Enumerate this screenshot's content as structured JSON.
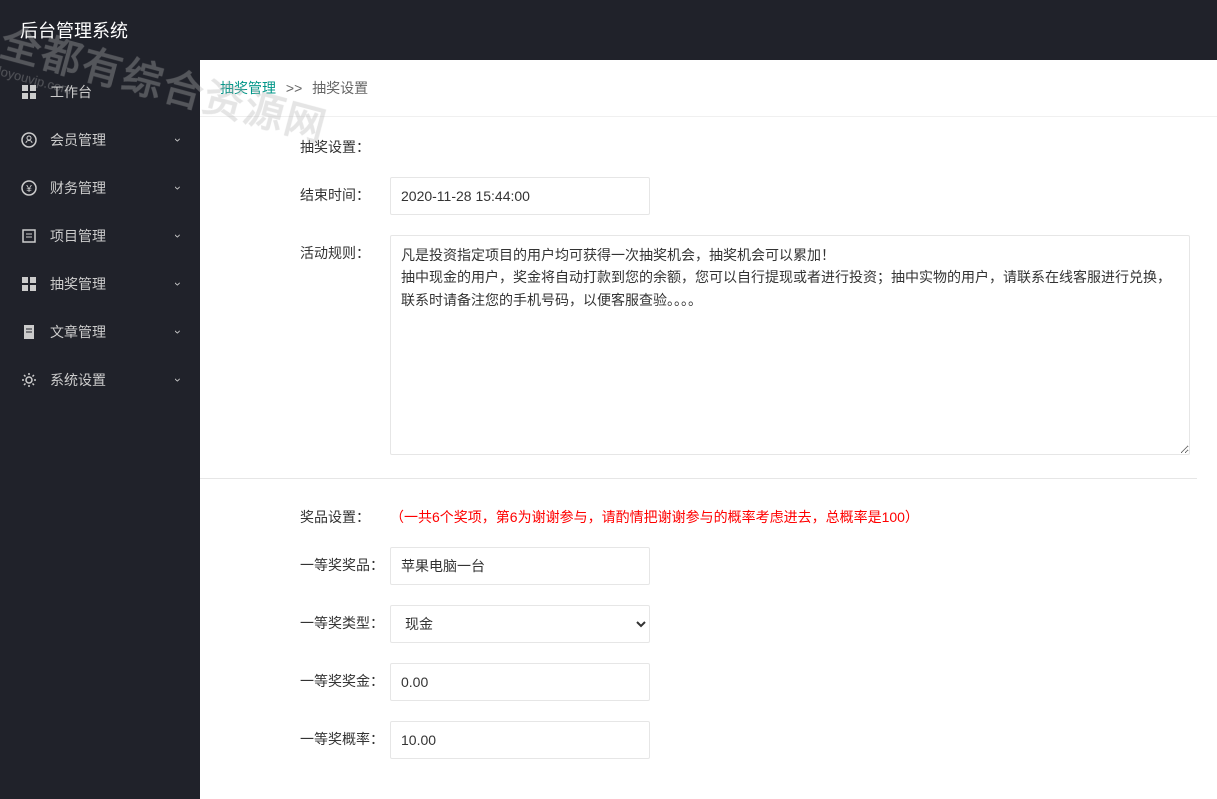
{
  "header": {
    "title": "后台管理系统"
  },
  "sidebar": {
    "items": [
      {
        "label": "工作台",
        "icon": "grid",
        "has_sub": false
      },
      {
        "label": "会员管理",
        "icon": "user",
        "has_sub": true
      },
      {
        "label": "财务管理",
        "icon": "money",
        "has_sub": true
      },
      {
        "label": "项目管理",
        "icon": "project",
        "has_sub": true
      },
      {
        "label": "抽奖管理",
        "icon": "lottery",
        "has_sub": true
      },
      {
        "label": "文章管理",
        "icon": "article",
        "has_sub": true
      },
      {
        "label": "系统设置",
        "icon": "gear",
        "has_sub": true
      }
    ]
  },
  "breadcrumb": {
    "link": "抽奖管理",
    "sep": ">>",
    "current": "抽奖设置"
  },
  "form": {
    "section1_label": "抽奖设置：",
    "end_time": {
      "label": "结束时间：",
      "value": "2020-11-28 15:44:00"
    },
    "rules": {
      "label": "活动规则：",
      "value": "凡是投资指定项目的用户均可获得一次抽奖机会，抽奖机会可以累加！\n抽中现金的用户，奖金将自动打款到您的余额，您可以自行提现或者进行投资；抽中实物的用户，请联系在线客服进行兑换，联系时请备注您的手机号码，以便客服查验。。。。"
    },
    "prize_section_label": "奖品设置：",
    "prize_help": "（一共6个奖项，第6为谢谢参与，请酌情把谢谢参与的概率考虑进去，总概率是100）",
    "prize1_name": {
      "label": "一等奖奖品：",
      "value": "苹果电脑一台"
    },
    "prize1_type": {
      "label": "一等奖类型：",
      "value": "现金",
      "options": [
        "现金"
      ]
    },
    "prize1_money": {
      "label": "一等奖奖金：",
      "value": "0.00"
    },
    "prize1_prob": {
      "label": "一等奖概率：",
      "value": "10.00"
    }
  },
  "watermark": {
    "main": "全都有综合资源网",
    "sub": "doyouvip.com"
  }
}
